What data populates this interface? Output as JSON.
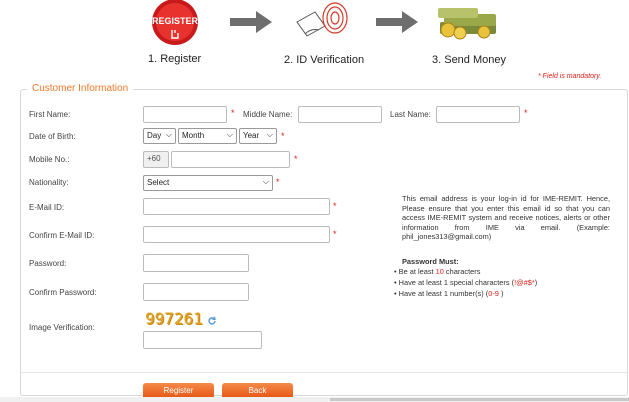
{
  "steps": [
    {
      "label": "1. Register",
      "badge": "REGISTER",
      "icon": "register-hand-icon"
    },
    {
      "label": "2. ID Verification",
      "icon": "fingerprint-card-icon"
    },
    {
      "label": "3. Send Money",
      "icon": "money-stack-icon"
    }
  ],
  "mandatory_note": "* Field is mandatory.",
  "section_title": "Customer Information",
  "fields": {
    "first_name": "First Name:",
    "middle_name": "Middle Name:",
    "last_name": "Last Name:",
    "dob": "Date of Birth:",
    "mobile": "Mobile No.:",
    "nationality": "Nationality:",
    "email": "E-Mail ID:",
    "confirm_email": "Confirm E-Mail ID:",
    "password": "Password:",
    "confirm_password": "Confirm Password:",
    "image_verification": "Image Verification:"
  },
  "dob_selects": {
    "day": "Day",
    "month": "Month",
    "year": "Year"
  },
  "mobile_prefix": "+60",
  "nationality_select": "Select",
  "email_note": "This email address is your log-in id for IME-REMIT. Hence, Please ensure that you enter this email id so that you can access IME-REMIT system and receive notices, alerts or other information from IME via email. (Example: phil_jones313@gmail.com)",
  "password_rules": {
    "title": "Password Must:",
    "rule1_pre": "Be at least ",
    "rule1_val": "10",
    "rule1_post": " characters",
    "rule2_pre": "Have at least 1 special characters (",
    "rule2_val": "!@#$*",
    "rule2_post": ")",
    "rule3_pre": "Have at least 1 number(s) (",
    "rule3_val": "0-9",
    "rule3_post": " )"
  },
  "captcha": "997261",
  "buttons": {
    "register": "Register",
    "back": "Back"
  },
  "colors": {
    "accent": "#f07a2a",
    "required": "#e0201a",
    "button": "#e85a18"
  }
}
